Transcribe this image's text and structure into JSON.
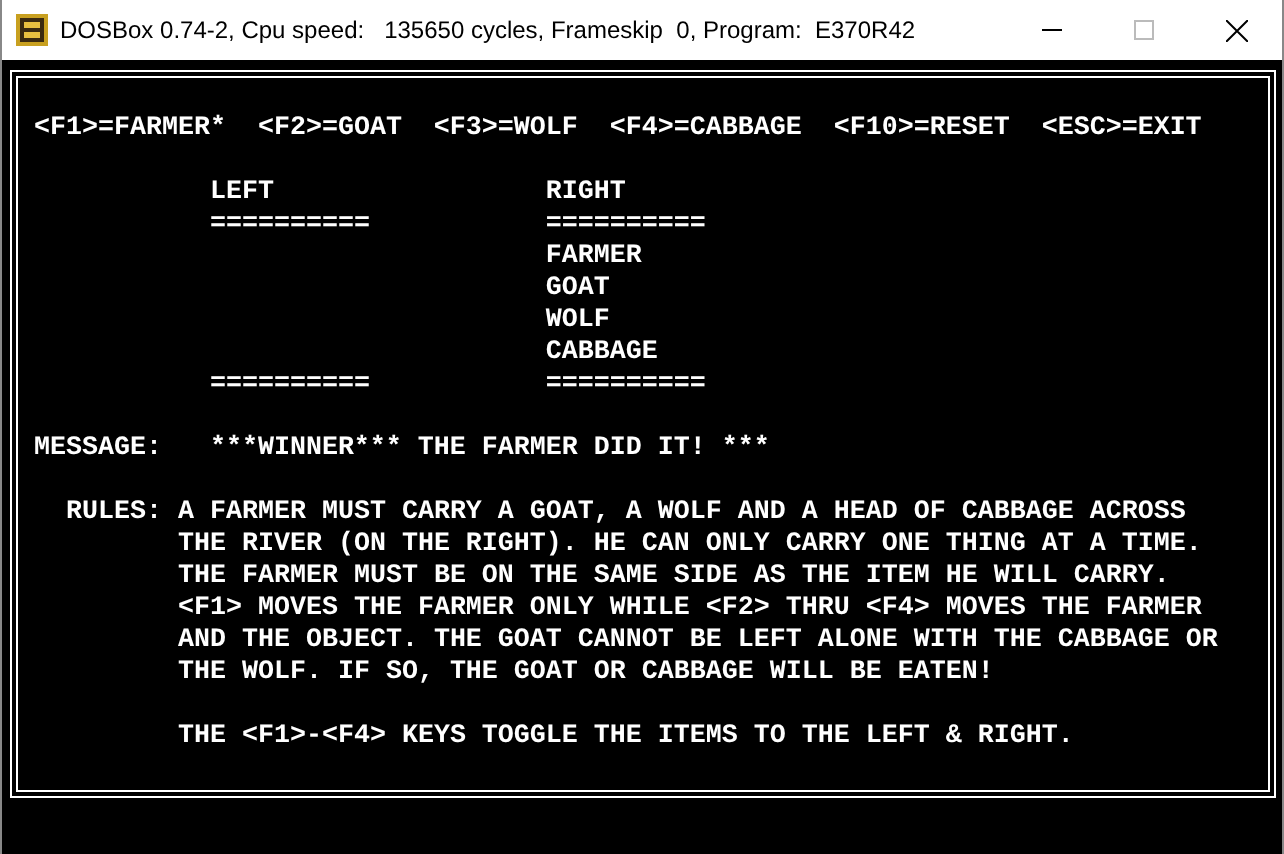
{
  "window": {
    "title": "DOSBox 0.74-2, Cpu speed:   135650 cycles, Frameskip  0, Program:  E370R42"
  },
  "keys": [
    "<F1>=FARMER*",
    "<F2>=GOAT",
    "<F3>=WOLF",
    "<F4>=CABBAGE",
    "<F10>=RESET",
    "<ESC>=EXIT"
  ],
  "banks": [
    {
      "heading": "LEFT",
      "rule_top": "==========",
      "rule_bottom": "=========="
    },
    {
      "heading": "RIGHT",
      "rule_top": "==========",
      "items": [
        "FARMER",
        "GOAT",
        "WOLF",
        "CABBAGE"
      ],
      "rule_bottom": "=========="
    }
  ],
  "message": {
    "label": "MESSAGE:",
    "text": "***WINNER*** THE FARMER DID IT! ***"
  },
  "rules": {
    "label": "RULES:",
    "lines": [
      "A FARMER MUST CARRY A GOAT, A WOLF AND A HEAD OF CABBAGE ACROSS",
      "THE RIVER (ON THE RIGHT). HE CAN ONLY CARRY ONE THING AT A TIME.",
      "THE FARMER MUST BE ON THE SAME SIDE AS THE ITEM HE WILL CARRY.",
      "<F1> MOVES THE FARMER ONLY WHILE <F2> THRU <F4> MOVES THE FARMER",
      "AND THE OBJECT. THE GOAT CANNOT BE LEFT ALONE WITH THE CABBAGE OR",
      "THE WOLF. IF SO, THE GOAT OR CABBAGE WILL BE EATEN!"
    ],
    "footer": "THE <F1>-<F4> KEYS TOGGLE THE ITEMS TO THE LEFT & RIGHT."
  }
}
